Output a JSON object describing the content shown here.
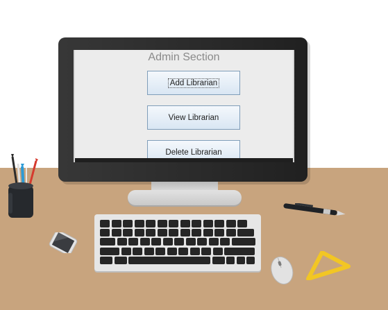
{
  "app": {
    "title": "Admin Section",
    "buttons": [
      {
        "label": "Add Librarian",
        "focused": true
      },
      {
        "label": "View Librarian",
        "focused": false
      },
      {
        "label": "Delete Librarian",
        "focused": false
      }
    ]
  },
  "scene": {
    "desk_color": "#c8a47e",
    "monitor_color": "#2b2b2b",
    "screen_background": "#ececec",
    "button_border_color": "#7f9db9",
    "pencil_colors": [
      "#2b2b2b",
      "#e0e0e0",
      "#2d9bd6",
      "#d53a2e"
    ],
    "triangle_color": "#f2c624"
  }
}
